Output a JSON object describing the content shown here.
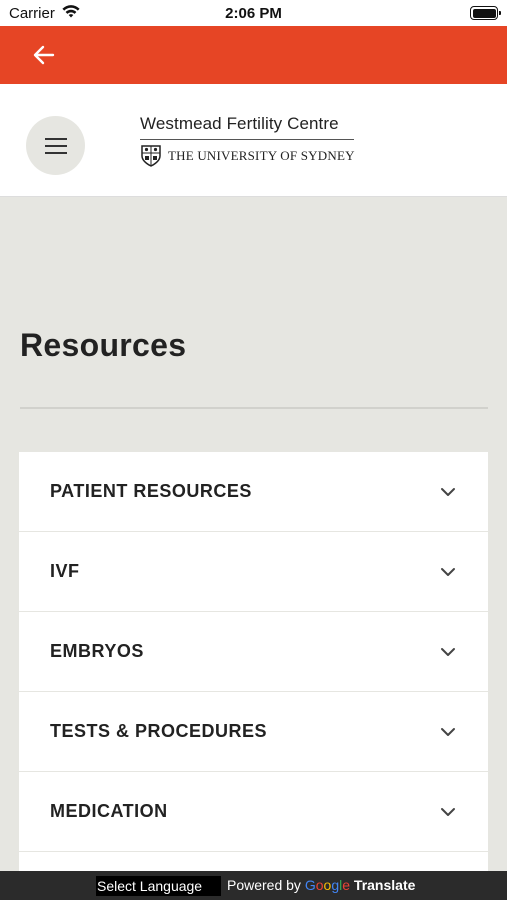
{
  "status_bar": {
    "carrier": "Carrier",
    "time": "2:06 PM"
  },
  "nav": {
    "accent_color": "#e64525",
    "back_icon": "arrow-left-icon"
  },
  "header": {
    "menu_icon": "hamburger-icon",
    "logo": {
      "org_name": "Westmead Fertility Centre",
      "university": "THE UNIVERSITY OF SYDNEY",
      "crest_icon": "university-crest-icon"
    }
  },
  "main": {
    "title": "Resources",
    "accordion": [
      {
        "label": "PATIENT RESOURCES"
      },
      {
        "label": "IVF"
      },
      {
        "label": "EMBRYOS"
      },
      {
        "label": "TESTS & PROCEDURES"
      },
      {
        "label": "MEDICATION"
      }
    ]
  },
  "translate_bar": {
    "select_label": "Select Language",
    "powered_by": "Powered by",
    "google": "Google",
    "translate": "Translate"
  }
}
